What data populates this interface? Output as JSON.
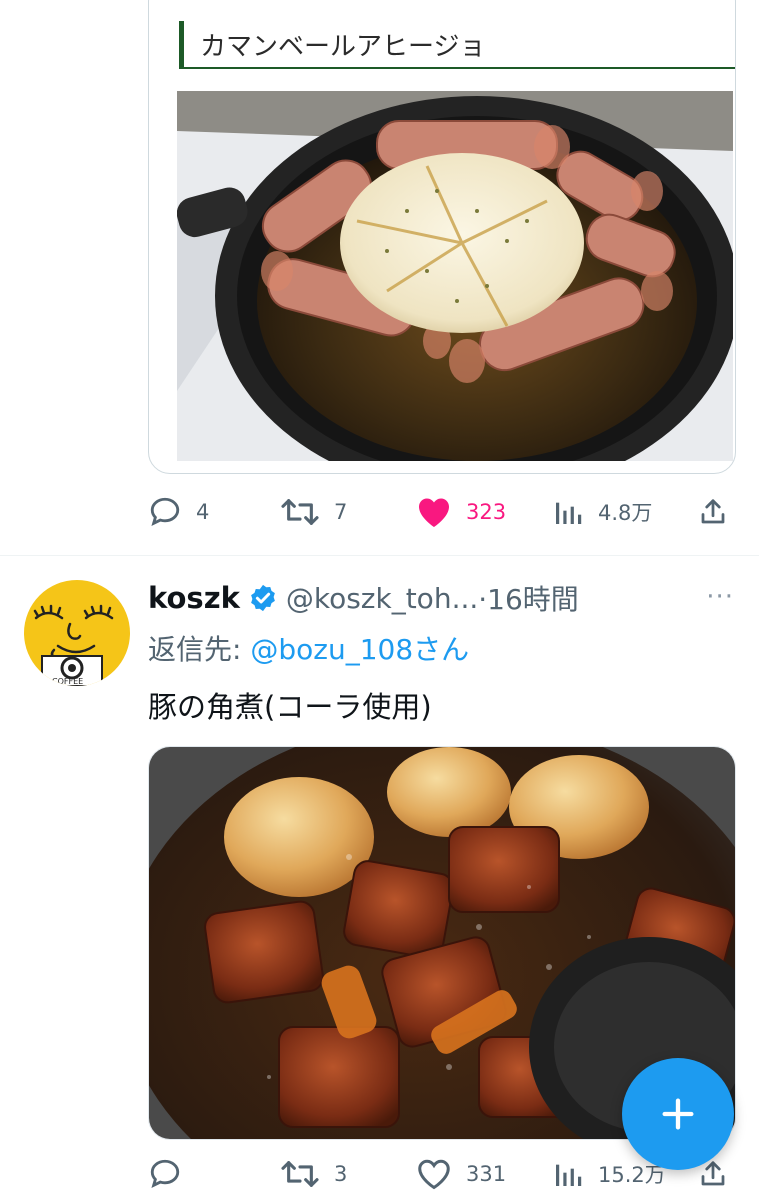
{
  "quoted_card": {
    "title": "カマンベールアヒージョ",
    "image_icon": "camembert-ajillo-photo"
  },
  "tweet1_actions": {
    "replies": "4",
    "retweets": "7",
    "likes": "323",
    "views": "4.8万",
    "liked": true
  },
  "tweet2": {
    "display_name": "koszk",
    "handle": "@koszk_toh...",
    "time": "·16時間",
    "more": "···",
    "reply_prefix": "返信先: ",
    "reply_mention": "@bozu_108さん",
    "text": "豚の角煮(コーラ使用)",
    "image_icon": "braised-pork-photo",
    "actions": {
      "replies": "",
      "retweets": "3",
      "likes": "331",
      "views": "15.2万"
    }
  },
  "fab": {
    "icon": "plus-icon"
  },
  "colors": {
    "accent": "#1d9bf0",
    "like": "#f91880",
    "muted": "#536471",
    "quote_border": "#1d5a27"
  }
}
